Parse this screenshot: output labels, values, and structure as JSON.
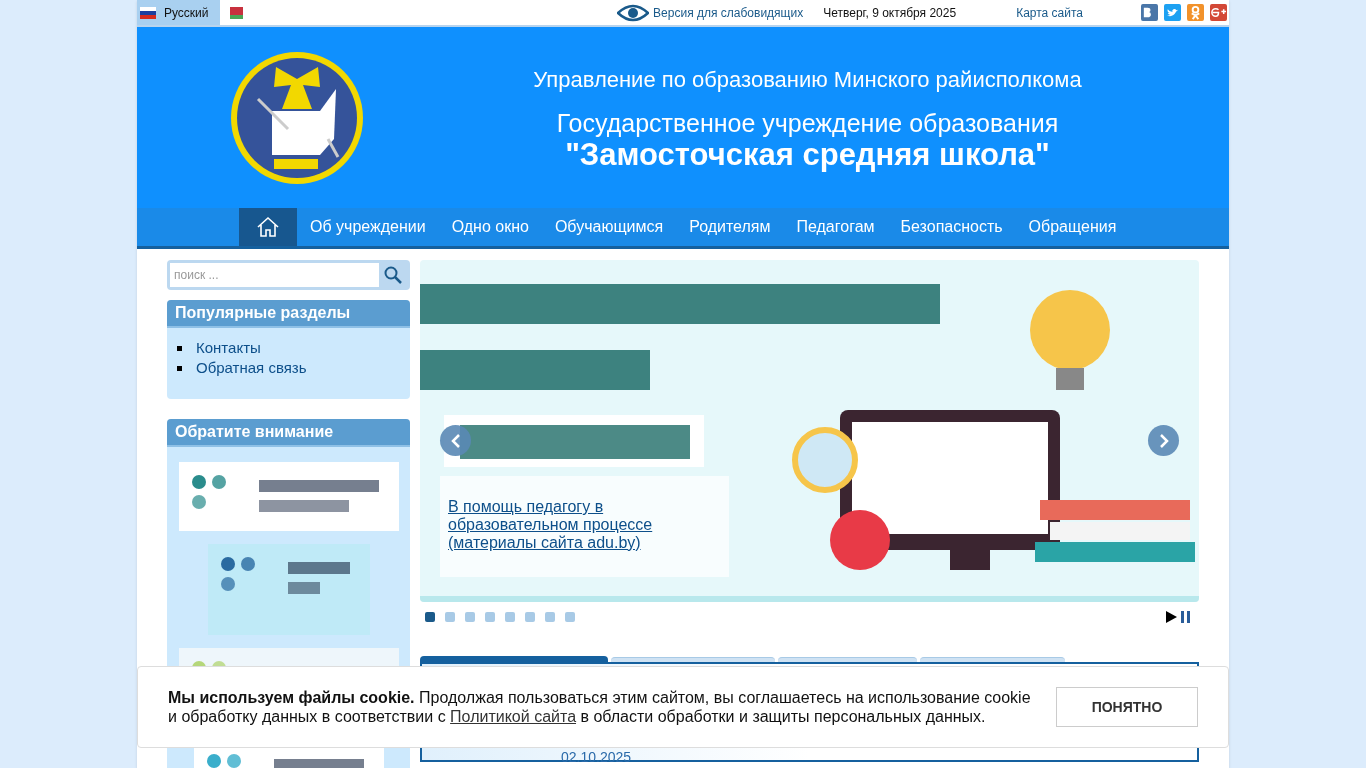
{
  "top_bar": {
    "languages": [
      {
        "label": "Русский",
        "kind": "russia",
        "selected": true
      },
      {
        "kind": "belarus",
        "selected": false
      }
    ],
    "accessibility_link": "Версия для слабовидящих",
    "date": "Четверг, 9 октября 2025",
    "sitemap_link": "Карта сайта",
    "social": [
      {
        "kind": "vk"
      },
      {
        "kind": "twitter"
      },
      {
        "kind": "ok"
      },
      {
        "kind": "gplus"
      }
    ]
  },
  "header": {
    "subtitle": "Управление по образованию Минского райисполкома",
    "title_line1": "Государственное учреждение образования",
    "title_line2": "\"Замосточская средняя школа\""
  },
  "nav": {
    "items": [
      {
        "kind": "home",
        "selected": true
      },
      {
        "label": "Об учреждении",
        "selected": false
      },
      {
        "label": "Одно окно",
        "selected": false
      },
      {
        "label": "Обучающимся",
        "selected": false
      },
      {
        "label": "Родителям",
        "selected": false
      },
      {
        "label": "Педагогам",
        "selected": false
      },
      {
        "label": "Безопасность",
        "selected": false
      },
      {
        "label": "Обращения",
        "selected": false
      }
    ]
  },
  "search": {
    "placeholder": "поиск ..."
  },
  "popular": {
    "title": "Популярные разделы",
    "links": [
      "Контакты",
      "Обратная связь"
    ]
  },
  "attention": {
    "title": "Обратите внимание"
  },
  "slider": {
    "caption": "В помощь педагогу в образовательном процессе (материалы сайта adu.by)",
    "dots": [
      {
        "selected": true
      },
      {
        "selected": false
      },
      {
        "selected": false
      },
      {
        "selected": false
      },
      {
        "selected": false
      },
      {
        "selected": false
      },
      {
        "selected": false
      },
      {
        "selected": false
      }
    ]
  },
  "tabs": [
    {
      "selected": true
    },
    {
      "selected": false
    },
    {
      "selected": false
    },
    {
      "selected": false
    }
  ],
  "news": {
    "date": "02.10.2025"
  },
  "cookie": {
    "text": "**Мы используем файлы cookie.** Продолжая пользоваться этим сайтом, вы соглашаетесь на использование cookie и обработку данных в соответствии с",
    "link": "Политикой сайта",
    "text_end": "в области обработки и защиты персональных данных.",
    "button": "ПОНЯТНО"
  }
}
